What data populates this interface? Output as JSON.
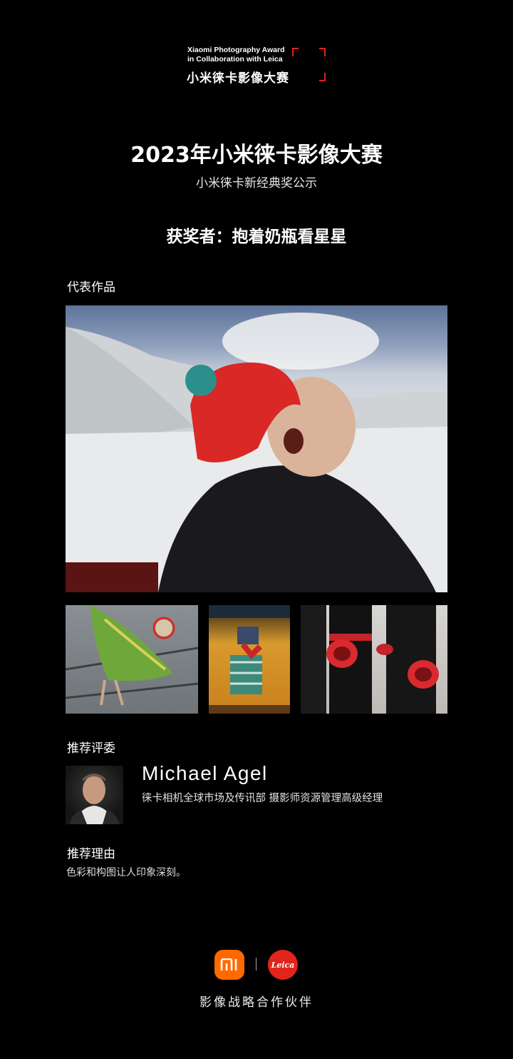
{
  "header": {
    "award_en_line1": "Xiaomi Photography Award",
    "award_en_line2": "in Collaboration with Leica",
    "award_cn": "小米徕卡影像大赛"
  },
  "title": "2023年小米徕卡影像大赛",
  "subtitle": "小米徕卡新经典奖公示",
  "winner": "获奖者：抱着奶瓶看星星",
  "works": {
    "label": "代表作品"
  },
  "judge": {
    "label": "推荐评委",
    "name": "Michael Agel",
    "title": "徕卡相机全球市场及传讯部 摄影师资源管理高级经理"
  },
  "reason": {
    "label": "推荐理由",
    "text": "色彩和构图让人印象深刻。"
  },
  "footer": {
    "mi_logo_text": "mi",
    "leica_logo_text": "Leica",
    "partner_text": "影像战略合作伙伴"
  },
  "colors": {
    "background": "#000000",
    "accent_red": "#e1251b",
    "mi_orange": "#ff6900"
  }
}
